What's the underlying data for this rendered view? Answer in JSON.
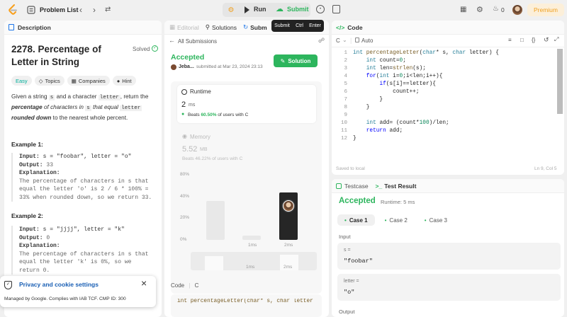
{
  "topbar": {
    "problem_list": "Problem List",
    "run": "Run",
    "submit": "Submit",
    "streak": "0",
    "premium": "Premium"
  },
  "submit_tooltip": {
    "label": "Submit",
    "key1": "Ctrl",
    "key2": "Enter"
  },
  "left": {
    "tab": "Description",
    "title": "2278. Percentage of Letter in String",
    "solved": "Solved",
    "tags": [
      "Easy",
      "Topics",
      "Companies",
      "Hint"
    ],
    "desc": {
      "p1": "Given a string ",
      "s": "s",
      "p2": " and a character ",
      "letter": "letter",
      "p3": ", return the ",
      "percentage": "percentage",
      "p4": " of characters in ",
      "s2": "s",
      "p5": " that equal ",
      "letter2": "letter",
      "p6": " ",
      "rounded": "rounded down",
      "p7": " to the nearest whole percent."
    },
    "ex1": {
      "heading": "Example 1:",
      "input_k": "Input:",
      "input_v": " s = \"foobar\", letter = \"o\"",
      "output_k": "Output:",
      "output_v": " 33",
      "expl_k": "Explanation:",
      "expl_v1": "The percentage of characters in s that",
      "expl_v2": "equal the letter 'o' is 2 / 6 * 100% =",
      "expl_v3": "33% when rounded down, so we return 33."
    },
    "ex2": {
      "heading": "Example 2:",
      "input_k": "Input:",
      "input_v": " s = \"jjjj\", letter = \"k\"",
      "output_k": "Output:",
      "output_v": " 0",
      "expl_k": "Explanation:",
      "expl_v1": "The percentage of characters in s that",
      "expl_v2": "equal the letter 'k' is 0%, so we",
      "expl_v3": "return 0."
    }
  },
  "cookie": {
    "title": "Privacy and cookie settings",
    "subtitle": "Managed by Google. Complies with IAB TCF. CMP ID: 300"
  },
  "middle": {
    "tabs": [
      "Editorial",
      "Solutions",
      "Subm"
    ],
    "all_submissions": "All Submissions",
    "status": "Accepted",
    "user": "Jeba...",
    "submitted_at": "submitted at Mar 23, 2024 23:13",
    "solution_btn": "Solution",
    "runtime_label": "Runtime",
    "runtime_value": "2",
    "runtime_unit": "ms",
    "beats_prefix": "Beats ",
    "beats_pct": "60.50%",
    "beats_suffix": " of users with C",
    "memory_label": "Memory",
    "memory_value": "5.52",
    "memory_unit": "MB",
    "memory_beats": "Beats 46.22% of users with C",
    "code_label": "Code",
    "code_lang": "C",
    "code_preview": "int percentageLetter(char* s, char letter"
  },
  "chart_data": {
    "type": "bar",
    "y_ticks": [
      "80%",
      "40%",
      "20%",
      "0%"
    ],
    "x_labels": [
      "1ms",
      "2ms"
    ],
    "values": [
      35,
      4,
      42
    ],
    "highlight_index": 2
  },
  "code": {
    "tab": "Code",
    "lang": "C",
    "mode": "Auto",
    "saved": "Saved to local",
    "position": "Ln 9, Col 5"
  },
  "result": {
    "tab_testcase": "Testcase",
    "tab_result": "Test Result",
    "status": "Accepted",
    "runtime": "Runtime: 5 ms",
    "cases": [
      "Case 1",
      "Case 2",
      "Case 3"
    ],
    "input_label": "Input",
    "s_label": "s =",
    "s_value": "\"foobar\"",
    "letter_label": "letter =",
    "letter_value": "\"o\"",
    "output_label": "Output"
  }
}
